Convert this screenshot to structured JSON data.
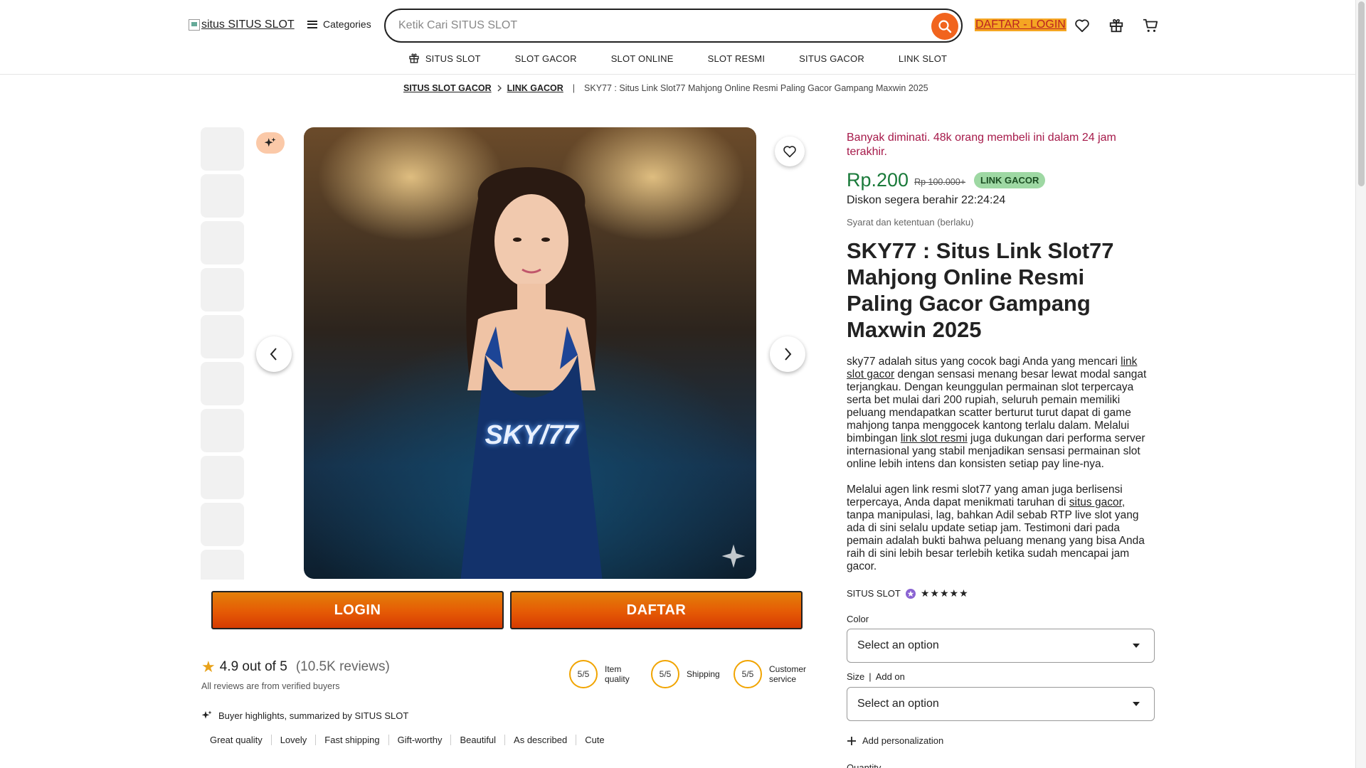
{
  "header": {
    "logo_alt": "situs SITUS SLOT",
    "categories_label": "Categories",
    "search_placeholder": "Ketik Cari SITUS SLOT",
    "auth_label": "DAFTAR - LOGIN",
    "icons": [
      "favorites-icon",
      "gift-icon",
      "cart-icon"
    ]
  },
  "nav": {
    "items": [
      {
        "label": "SITUS SLOT",
        "icon": "gift-icon"
      },
      {
        "label": "SLOT GACOR"
      },
      {
        "label": "SLOT ONLINE"
      },
      {
        "label": "SLOT RESMI"
      },
      {
        "label": "SITUS GACOR"
      },
      {
        "label": "LINK SLOT"
      }
    ]
  },
  "breadcrumb": {
    "items": [
      "SITUS SLOT GACOR",
      "LINK GACOR"
    ],
    "current": "SKY77 : Situs Link Slot77 Mahjong Online Resmi Paling Gacor Gampang Maxwin 2025"
  },
  "gallery": {
    "thumb_count": 10,
    "hero_brand": "SKY/77"
  },
  "cta": {
    "login_label": "LOGIN",
    "daftar_label": "DAFTAR"
  },
  "reviews": {
    "rating_text": "4.9 out of 5",
    "count_text": "(10.5K reviews)",
    "verified_note": "All reviews are from verified buyers",
    "scores": [
      {
        "value": "5/5",
        "label": "Item quality"
      },
      {
        "value": "5/5",
        "label": "Shipping"
      },
      {
        "value": "5/5",
        "label": "Customer service"
      }
    ],
    "highlights_title": "Buyer highlights, summarized by SITUS SLOT",
    "tags": [
      "Great quality",
      "Lovely",
      "Fast shipping",
      "Gift-worthy",
      "Beautiful",
      "As described",
      "Cute"
    ]
  },
  "product": {
    "popularity": "Banyak diminati. 48k orang membeli ini dalam 24 jam terakhir.",
    "price": "Rp.200",
    "old_price": "Rp 100.000+",
    "badge": "LINK GACOR",
    "discount": "Diskon segera berahir 22:24:24",
    "terms": "Syarat dan ketentuan (berlaku)",
    "title": "SKY77 : Situs Link Slot77 Mahjong Online Resmi Paling Gacor Gampang Maxwin 2025",
    "desc1": {
      "t1": "sky77 adalah situs yang cocok bagi Anda yang mencari ",
      "l1": "link slot gacor",
      "t2": " dengan sensasi menang besar lewat modal sangat terjangkau. Dengan keunggulan permainan slot terpercaya serta bet mulai dari 200 rupiah, seluruh pemain memiliki peluang mendapatkan scatter berturut turut dapat di game mahjong tanpa menggocek kantong terlalu dalam. Melalui bimbingan ",
      "l2": "link slot resmi",
      "t3": " juga dukungan dari performa server internasional yang stabil menjadikan sensasi permainan slot online lebih intens dan konsisten setiap pay line-nya."
    },
    "desc2": {
      "t1": "Melalui agen link resmi slot77 yang aman juga berlisensi terpercaya, Anda dapat menikmati taruhan di ",
      "l1": "situs gacor",
      "t2": ", tanpa manipulasi, lag, bahkan Adil sebab RTP live slot yang ada di sini selalu update setiap jam. Testimoni dari pada pemain adalah bukti bahwa peluang menang yang bisa Anda raih di sini lebih besar terlebih ketika sudah mencapai jam gacor."
    },
    "seller": "SITUS SLOT",
    "stars": "★★★★★",
    "rating_value": 5,
    "color_label": "Color",
    "color_select": "Select an option",
    "size_label": "Size",
    "size_addon": "Add on",
    "size_select": "Select an option",
    "personalization": "Add personalization",
    "quantity_label": "Quantity"
  },
  "colors": {
    "accent": "#f1641e",
    "price_green": "#1a7a3a",
    "popular_red": "#a61a4a",
    "badge_green": "#9ed8a3"
  }
}
